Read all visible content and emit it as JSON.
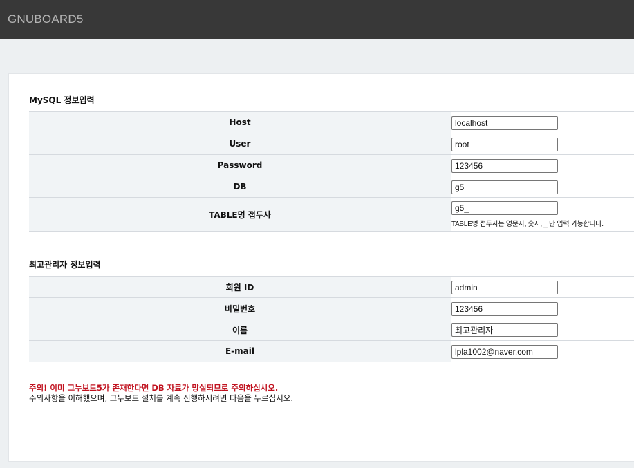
{
  "header": {
    "logo": "GNUBOARD5"
  },
  "mysql": {
    "title": "MySQL 정보입력",
    "fields": [
      {
        "label": "Host",
        "value": "localhost"
      },
      {
        "label": "User",
        "value": "root"
      },
      {
        "label": "Password",
        "value": "123456"
      },
      {
        "label": "DB",
        "value": "g5"
      },
      {
        "label": "TABLE명 접두사",
        "value": "g5_",
        "help": "TABLE명 접두사는 영문자, 숫자, _ 만 입력 가능합니다."
      }
    ]
  },
  "admin": {
    "title": "최고관리자 정보입력",
    "fields": [
      {
        "label": "회원 ID",
        "value": "admin"
      },
      {
        "label": "비밀번호",
        "value": "123456"
      },
      {
        "label": "이름",
        "value": "최고관리자"
      },
      {
        "label": "E-mail",
        "value": "lpla1002@naver.com"
      }
    ]
  },
  "notice": {
    "warning": "주의! 이미 그누보드5가 존재한다면 DB 자료가 망실되므로 주의하십시오.",
    "info": "주의사항을 이해했으며, 그누보드 설치를 계속 진행하시려면 다음을 누르십시오."
  }
}
